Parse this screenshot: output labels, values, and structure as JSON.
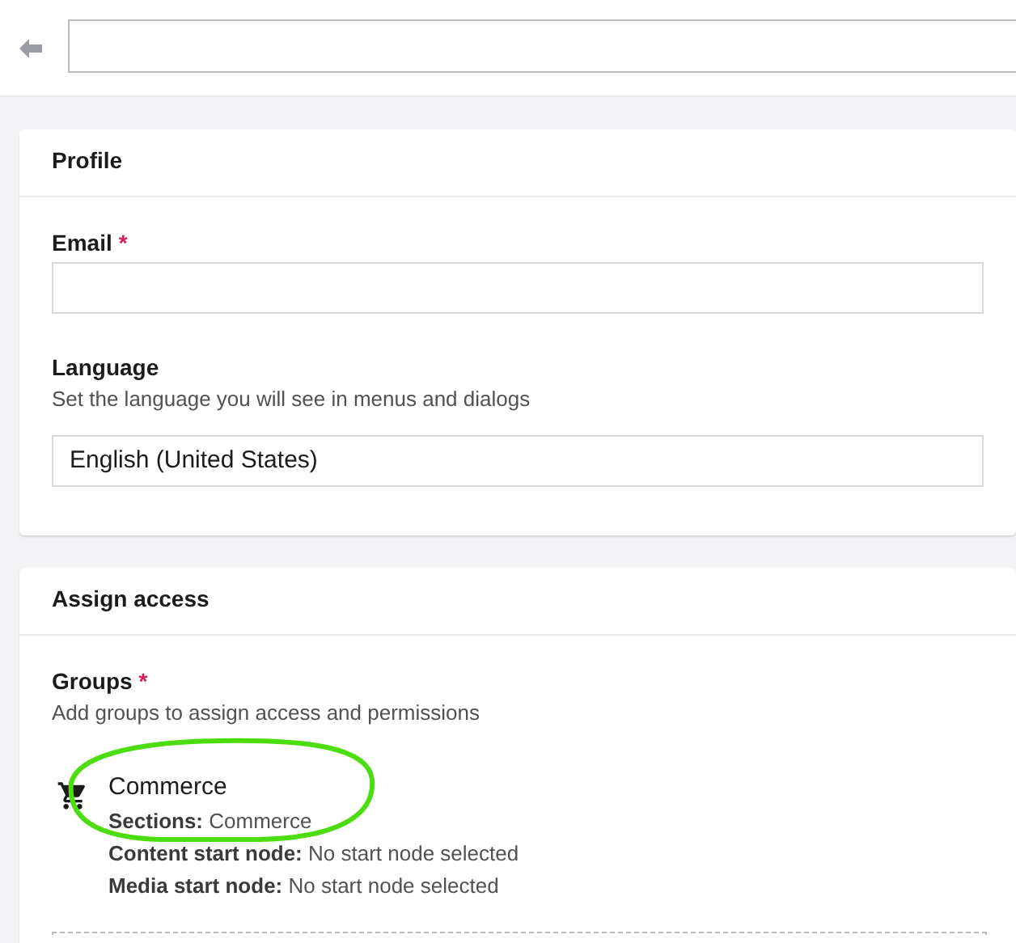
{
  "profile": {
    "title": "Profile",
    "fields": [
      {
        "kind": "text",
        "label": "Email",
        "required_mark": "*"
      },
      {
        "kind": "select",
        "label": "Language",
        "description": "Set the language you will see in menus and dialogs",
        "value": "English (United States)"
      }
    ]
  },
  "assign_access": {
    "title": "Assign access",
    "label": "Groups",
    "required_mark": "*",
    "description": "Add groups to assign access and permissions",
    "groups": [
      {
        "name": "Commerce",
        "details": [
          {
            "label": "Sections:",
            "value": "Commerce"
          },
          {
            "label": "Content start node:",
            "value": "No start node selected"
          },
          {
            "label": "Media start node:",
            "value": "No start node selected"
          }
        ]
      }
    ]
  }
}
